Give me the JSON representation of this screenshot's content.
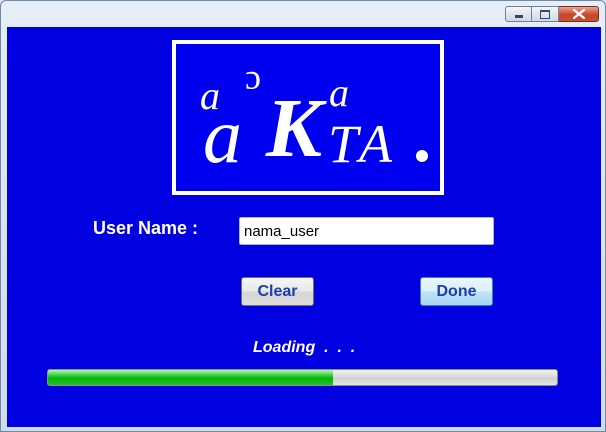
{
  "window": {
    "caption_buttons": [
      "minimize-icon",
      "maximize-icon",
      "close-icon"
    ]
  },
  "logo": {
    "text": "acaKTA.",
    "colors": {
      "background": "#0000f0",
      "border": "#ffffff",
      "glyphs": "#ffffff"
    }
  },
  "form": {
    "username_label": "User Name :",
    "username_value": "nama_user",
    "clear_label": "Clear",
    "done_label": "Done"
  },
  "loading": {
    "text": "Loading  .  .  .",
    "progress": 0.56
  },
  "colors": {
    "background": "#0000e0",
    "progress_fill": "#08b010",
    "button_text": "#1b3fa8"
  }
}
